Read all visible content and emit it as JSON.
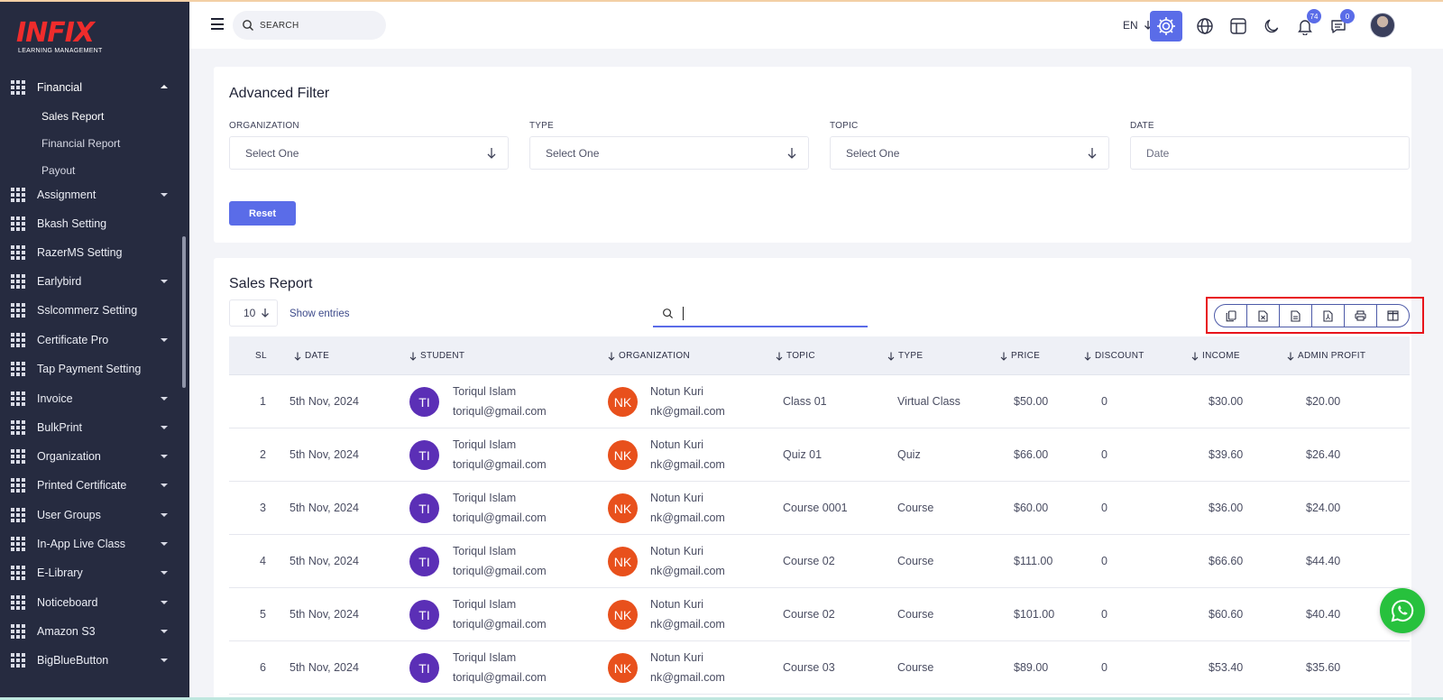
{
  "brand": {
    "name": "INFIX",
    "tagline": "LEARNING MANAGEMENT"
  },
  "sidebar": {
    "active_section": "Financial",
    "sub_items": [
      "Sales Report",
      "Financial Report",
      "Payout"
    ],
    "items": [
      "Assignment",
      "Bkash Setting",
      "RazerMS Setting",
      "Earlybird",
      "Sslcommerz Setting",
      "Certificate Pro",
      "Tap Payment Setting",
      "Invoice",
      "BulkPrint",
      "Organization",
      "Printed Certificate",
      "User Groups",
      "In-App Live Class",
      "E-Library",
      "Noticeboard",
      "Amazon S3",
      "BigBlueButton"
    ]
  },
  "header": {
    "search_placeholder": "SEARCH",
    "language": "EN",
    "notifications_count": "74",
    "messages_count": "0"
  },
  "filter": {
    "title": "Advanced Filter",
    "fields": [
      {
        "label": "ORGANIZATION",
        "value": "Select One"
      },
      {
        "label": "TYPE",
        "value": "Select One"
      },
      {
        "label": "TOPIC",
        "value": "Select One"
      },
      {
        "label": "DATE",
        "value": "Date"
      }
    ],
    "reset_label": "Reset"
  },
  "report": {
    "title": "Sales Report",
    "page_length": "10",
    "show_entries": "Show entries",
    "columns": [
      "SL",
      "DATE",
      "STUDENT",
      "ORGANIZATION",
      "TOPIC",
      "TYPE",
      "PRICE",
      "DISCOUNT",
      "INCOME",
      "ADMIN PROFIT"
    ],
    "rows": [
      {
        "sl": "1",
        "date": "5th Nov, 2024",
        "student_initials": "TI",
        "student_name": "Toriqul Islam",
        "student_email": "toriqul@gmail.com",
        "org_initials": "NK",
        "org_name": "Notun Kuri",
        "org_email": "nk@gmail.com",
        "topic": "Class 01",
        "type": "Virtual Class",
        "price": "$50.00",
        "discount": "0",
        "income": "$30.00",
        "admin_profit": "$20.00"
      },
      {
        "sl": "2",
        "date": "5th Nov, 2024",
        "student_initials": "TI",
        "student_name": "Toriqul Islam",
        "student_email": "toriqul@gmail.com",
        "org_initials": "NK",
        "org_name": "Notun Kuri",
        "org_email": "nk@gmail.com",
        "topic": "Quiz 01",
        "type": "Quiz",
        "price": "$66.00",
        "discount": "0",
        "income": "$39.60",
        "admin_profit": "$26.40"
      },
      {
        "sl": "3",
        "date": "5th Nov, 2024",
        "student_initials": "TI",
        "student_name": "Toriqul Islam",
        "student_email": "toriqul@gmail.com",
        "org_initials": "NK",
        "org_name": "Notun Kuri",
        "org_email": "nk@gmail.com",
        "topic": "Course 0001",
        "type": "Course",
        "price": "$60.00",
        "discount": "0",
        "income": "$36.00",
        "admin_profit": "$24.00"
      },
      {
        "sl": "4",
        "date": "5th Nov, 2024",
        "student_initials": "TI",
        "student_name": "Toriqul Islam",
        "student_email": "toriqul@gmail.com",
        "org_initials": "NK",
        "org_name": "Notun Kuri",
        "org_email": "nk@gmail.com",
        "topic": "Course 02",
        "type": "Course",
        "price": "$111.00",
        "discount": "0",
        "income": "$66.60",
        "admin_profit": "$44.40"
      },
      {
        "sl": "5",
        "date": "5th Nov, 2024",
        "student_initials": "TI",
        "student_name": "Toriqul Islam",
        "student_email": "toriqul@gmail.com",
        "org_initials": "NK",
        "org_name": "Notun Kuri",
        "org_email": "nk@gmail.com",
        "topic": "Course 02",
        "type": "Course",
        "price": "$101.00",
        "discount": "0",
        "income": "$60.60",
        "admin_profit": "$40.40"
      },
      {
        "sl": "6",
        "date": "5th Nov, 2024",
        "student_initials": "TI",
        "student_name": "Toriqul Islam",
        "student_email": "toriqul@gmail.com",
        "org_initials": "NK",
        "org_name": "Notun Kuri",
        "org_email": "nk@gmail.com",
        "topic": "Course 03",
        "type": "Course",
        "price": "$89.00",
        "discount": "0",
        "income": "$53.40",
        "admin_profit": "$35.60"
      }
    ]
  },
  "colors": {
    "primary": "#5a6ce8",
    "sidebar_bg": "#262b40",
    "brand_red": "#ef2c2c",
    "student_avatar": "#5b2fb6",
    "org_avatar": "#e8501c",
    "whatsapp": "#27c13d",
    "highlight_box": "#e8141b"
  }
}
